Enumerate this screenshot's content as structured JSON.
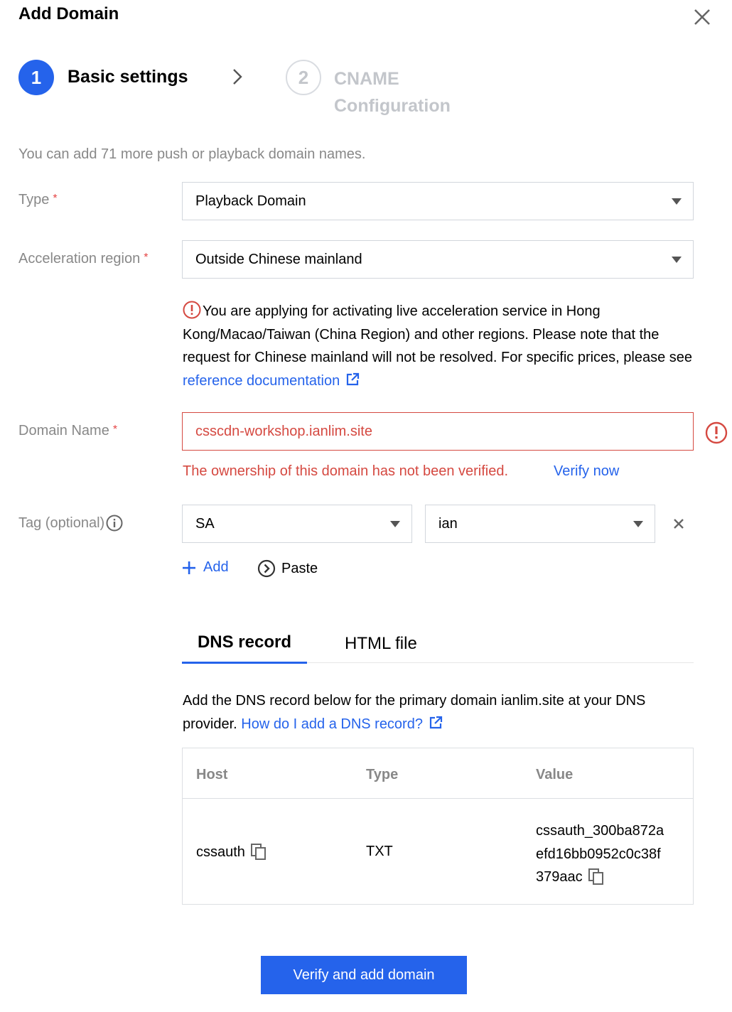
{
  "dialog": {
    "title": "Add Domain"
  },
  "steps": [
    {
      "number": "1",
      "label": "Basic settings"
    },
    {
      "number": "2",
      "label": "CNAME Configuration"
    }
  ],
  "hint": "You can add 71 more push or playback domain names.",
  "form": {
    "type_label": "Type",
    "type_value": "Playback Domain",
    "region_label": "Acceleration region",
    "region_value": "Outside Chinese mainland",
    "region_warning": "You are applying for activating live acceleration service in Hong Kong/Macao/Taiwan (China Region) and other regions. Please note that the request for Chinese mainland will not be resolved. For specific prices, please see",
    "region_warning_link": "reference documentation",
    "domain_label": "Domain Name",
    "domain_value": "csscdn-workshop.ianlim.site",
    "domain_error": "The ownership of this domain has not been verified.",
    "verify_now": "Verify now",
    "tag_label": "Tag (optional)",
    "tag_key": "SA",
    "tag_value": "ian",
    "add_label": "Add",
    "paste_label": "Paste",
    "required_mark": "*"
  },
  "tabs": [
    {
      "label": "DNS record",
      "active": true
    },
    {
      "label": "HTML file",
      "active": false
    }
  ],
  "dns": {
    "description": "Add the DNS record below for the primary domain ianlim.site at your DNS provider.",
    "help_link": "How do I add a DNS record?",
    "columns": [
      "Host",
      "Type",
      "Value"
    ],
    "row": {
      "host": "cssauth",
      "type": "TXT",
      "value_lines": [
        "cssauth_300ba872a",
        "efd16bb0952c0c38f",
        "379aac"
      ]
    }
  },
  "primary_button": "Verify and add domain",
  "colors": {
    "accent": "#2563eb",
    "error": "#d54941",
    "muted": "#888888"
  }
}
